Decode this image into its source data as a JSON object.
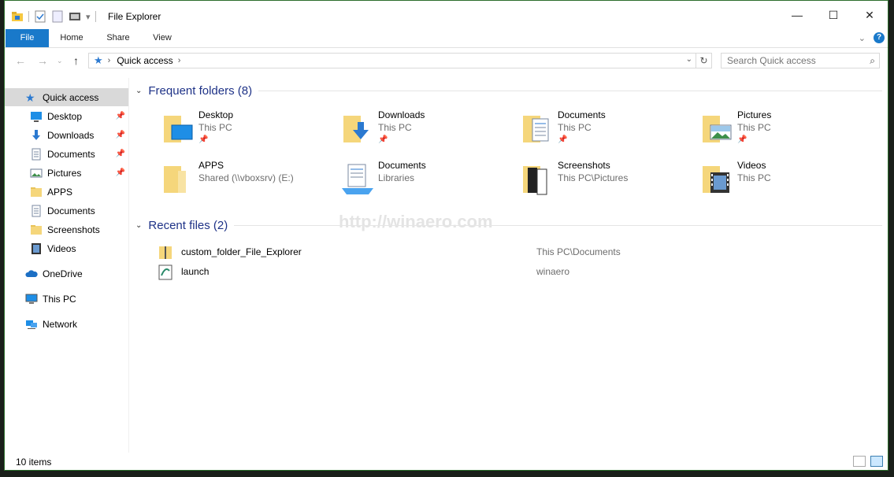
{
  "window": {
    "title": "File Explorer",
    "controls": [
      "—",
      "☐",
      "✕"
    ]
  },
  "ribbon": {
    "tabs": [
      {
        "label": "File"
      },
      {
        "label": "Home"
      },
      {
        "label": "Share"
      },
      {
        "label": "View"
      }
    ],
    "help": "?"
  },
  "address_bar": {
    "path": "Quick access",
    "search_placeholder": "Search Quick access"
  },
  "nav_pane": {
    "items": [
      {
        "label": "Quick access",
        "icon": "star-icon",
        "selected": true
      },
      {
        "label": "Desktop",
        "icon": "desktop-icon",
        "pinned": true
      },
      {
        "label": "Downloads",
        "icon": "download-arrow-icon",
        "pinned": true
      },
      {
        "label": "Documents",
        "icon": "document-icon",
        "pinned": true
      },
      {
        "label": "Pictures",
        "icon": "pictures-icon",
        "pinned": true
      },
      {
        "label": "APPS",
        "icon": "folder-icon"
      },
      {
        "label": "Documents",
        "icon": "document-icon"
      },
      {
        "label": "Screenshots",
        "icon": "folder-icon"
      },
      {
        "label": "Videos",
        "icon": "videos-icon"
      },
      {
        "label": "OneDrive",
        "icon": "cloud-icon"
      },
      {
        "label": "This PC",
        "icon": "computer-icon"
      },
      {
        "label": "Network",
        "icon": "network-icon"
      }
    ]
  },
  "frequent_folders": {
    "header": "Frequent folders (8)",
    "items": [
      {
        "name": "Desktop",
        "location": "This PC",
        "pinned": true,
        "icon": "desktop-folder-icon"
      },
      {
        "name": "Downloads",
        "location": "This PC",
        "pinned": true,
        "icon": "downloads-folder-icon"
      },
      {
        "name": "Documents",
        "location": "This PC",
        "pinned": true,
        "icon": "documents-folder-icon"
      },
      {
        "name": "Pictures",
        "location": "This PC",
        "pinned": true,
        "icon": "pictures-folder-icon"
      },
      {
        "name": "APPS",
        "location": "Shared (\\\\vboxsrv) (E:)",
        "pinned": false,
        "icon": "apps-folder-icon"
      },
      {
        "name": "Documents",
        "location": "Libraries",
        "pinned": false,
        "icon": "library-documents-icon"
      },
      {
        "name": "Screenshots",
        "location": "This PC\\Pictures",
        "pinned": false,
        "icon": "screenshots-folder-icon"
      },
      {
        "name": "Videos",
        "location": "This PC",
        "pinned": false,
        "icon": "videos-folder-icon"
      }
    ]
  },
  "recent_files": {
    "header": "Recent files (2)",
    "items": [
      {
        "name": "custom_folder_File_Explorer",
        "location": "This PC\\Documents",
        "icon": "zip-folder-icon"
      },
      {
        "name": "launch",
        "location": "winaero",
        "icon": "script-file-icon"
      }
    ]
  },
  "status": {
    "count": "10 items"
  },
  "watermark": "http://winaero.com",
  "colors": {
    "accent": "#1979ca",
    "group_header": "#1e3287",
    "folder_yellow": "#f5d67b"
  }
}
